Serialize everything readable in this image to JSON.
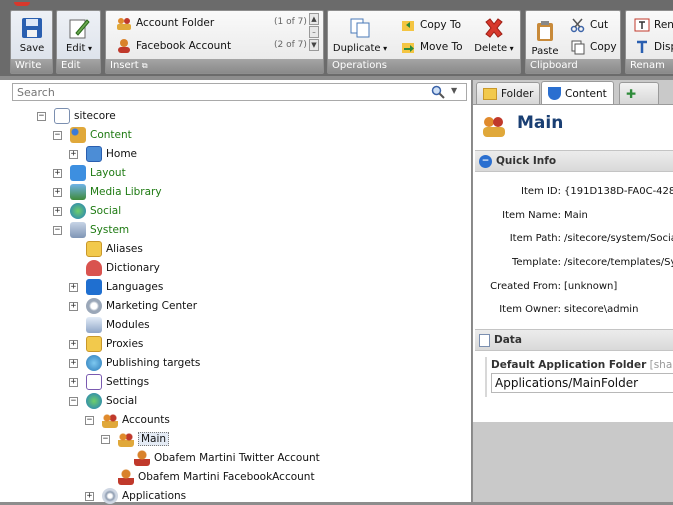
{
  "ribbon": {
    "write_group": {
      "save": "Save",
      "footer": "Write"
    },
    "edit_group": {
      "edit": "Edit",
      "footer": "Edit"
    },
    "insert_group": {
      "items": [
        {
          "label": "Account Folder",
          "count": "(1 of 7)"
        },
        {
          "label": "Facebook Account",
          "count": "(2 of 7)"
        }
      ],
      "footer": "Insert"
    },
    "operations_group": {
      "duplicate": "Duplicate",
      "copy_to": "Copy To",
      "move_to": "Move To",
      "delete": "Delete",
      "footer": "Operations"
    },
    "clipboard_group": {
      "paste": "Paste",
      "cut": "Cut",
      "copy": "Copy",
      "footer": "Clipboard"
    },
    "rename_group": {
      "rename": "Ren",
      "display": "Disp",
      "footer": "Renam"
    }
  },
  "search": {
    "placeholder": "Search"
  },
  "tree": {
    "root": "sitecore",
    "content": "Content",
    "home": "Home",
    "layout": "Layout",
    "media_library": "Media Library",
    "social_top": "Social",
    "system": "System",
    "aliases": "Aliases",
    "dictionary": "Dictionary",
    "languages": "Languages",
    "marketing_center": "Marketing Center",
    "modules": "Modules",
    "proxies": "Proxies",
    "publishing_targets": "Publishing targets",
    "settings": "Settings",
    "social": "Social",
    "accounts": "Accounts",
    "main": "Main",
    "twitter_account": "Obafem Martini Twitter Account",
    "facebook_account": "Obafem Martini FacebookAccount",
    "applications": "Applications"
  },
  "tabs": {
    "folder": "Folder",
    "content": "Content"
  },
  "item": {
    "title": "Main",
    "quick_info_header": "Quick Info",
    "fields": [
      {
        "label": "Item ID:",
        "value": "{191D138D-FA0C-428"
      },
      {
        "label": "Item Name:",
        "value": "Main"
      },
      {
        "label": "Item Path:",
        "value": "/sitecore/system/Socia"
      },
      {
        "label": "Template:",
        "value": "/sitecore/templates/Sy"
      },
      {
        "label": "Created From:",
        "value": "[unknown]"
      },
      {
        "label": "Item Owner:",
        "value": "sitecore\\admin"
      }
    ],
    "data_header": "Data",
    "field_label": "Default Application Folder",
    "field_suffix": "[shared",
    "field_value": "Applications/MainFolder"
  }
}
